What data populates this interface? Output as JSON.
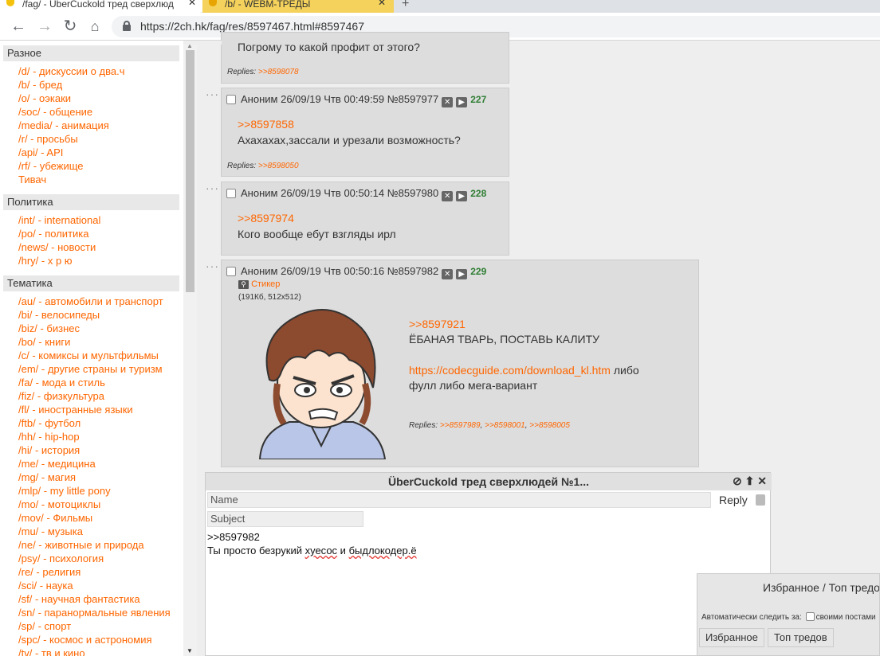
{
  "browser": {
    "tabs": [
      {
        "label": "/fag/ - ÜberCuckold тред сверхлюд"
      },
      {
        "label": "/b/ - WEBM-ТРЕДЫ"
      }
    ],
    "url": "https://2ch.hk/fag/res/8597467.html#8597467"
  },
  "sidebar": {
    "sections": [
      {
        "title": "Разное",
        "items": [
          {
            "label": "/d/ - дискуссии о два.ч"
          },
          {
            "label": "/b/ - бред"
          },
          {
            "label": "/o/ - оэкаки"
          },
          {
            "label": "/soc/ - общение"
          },
          {
            "label": "/media/ - анимация"
          },
          {
            "label": "/r/ - просьбы"
          },
          {
            "label": "/api/ - API"
          },
          {
            "label": "/rf/ - убежище"
          },
          {
            "label": "Тивач"
          }
        ]
      },
      {
        "title": "Политика",
        "items": [
          {
            "label": "/int/ - international"
          },
          {
            "label": "/po/ - политика"
          },
          {
            "label": "/news/ - новости"
          },
          {
            "label": "/hry/ - х р ю"
          }
        ]
      },
      {
        "title": "Тематика",
        "items": [
          {
            "label": "/au/ - автомобили и транспорт"
          },
          {
            "label": "/bi/ - велосипеды"
          },
          {
            "label": "/biz/ - бизнес"
          },
          {
            "label": "/bo/ - книги"
          },
          {
            "label": "/c/ - комиксы и мультфильмы"
          },
          {
            "label": "/em/ - другие страны и туризм"
          },
          {
            "label": "/fa/ - мода и стиль"
          },
          {
            "label": "/fiz/ - физкультура"
          },
          {
            "label": "/fl/ - иностранные языки"
          },
          {
            "label": "/ftb/ - футбол"
          },
          {
            "label": "/hh/ - hip-hop"
          },
          {
            "label": "/hi/ - история"
          },
          {
            "label": "/me/ - медицина"
          },
          {
            "label": "/mg/ - магия"
          },
          {
            "label": "/mlp/ - my little pony"
          },
          {
            "label": "/mo/ - мотоциклы"
          },
          {
            "label": "/mov/ - Фильмы"
          },
          {
            "label": "/mu/ - музыка"
          },
          {
            "label": "/ne/ - животные и природа"
          },
          {
            "label": "/psy/ - психология"
          },
          {
            "label": "/re/ - религия"
          },
          {
            "label": "/sci/ - наука"
          },
          {
            "label": "/sf/ - научная фантастика"
          },
          {
            "label": "/sn/ - паранормальные явления"
          },
          {
            "label": "/sp/ - спорт"
          },
          {
            "label": "/spc/ - космос и астрономия"
          },
          {
            "label": "/tv/ - тв и кино"
          }
        ]
      }
    ]
  },
  "posts": [
    {
      "text": "Погрому то какой профит от этого?",
      "replies_label": "Replies:",
      "replies": [
        ">>8598078"
      ]
    },
    {
      "name": "Аноним",
      "date": "26/09/19 Чтв 00:49:59",
      "num": "№8597977",
      "count": "227",
      "ref": ">>8597858",
      "text": "Ахахахах,зассали и урезали возможность?",
      "replies_label": "Replies:",
      "replies": [
        ">>8598050"
      ]
    },
    {
      "name": "Аноним",
      "date": "26/09/19 Чтв 00:50:14",
      "num": "№8597980",
      "count": "228",
      "ref": ">>8597974",
      "text": "Кого вообще ебут взгляды ирл"
    },
    {
      "name": "Аноним",
      "date": "26/09/19 Чтв 00:50:16",
      "num": "№8597982",
      "count": "229",
      "file_label": "Стикер",
      "file_meta": "(191Кб, 512x512)",
      "ref": ">>8597921",
      "text": "ЁБАНАЯ ТВАРЬ, ПОСТАВЬ КАЛИТУ",
      "link": "https://codecguide.com/download_kl.htm",
      "text2a": " либо",
      "text2b": "фулл либо мега-вариант",
      "replies_label": "Replies:",
      "replies": [
        ">>8597989",
        ">>8598001",
        ">>8598005"
      ]
    }
  ],
  "reply_form": {
    "title": "ÜberCuckold тред сверхлюдей №1...",
    "name_placeholder": "Name",
    "reply_label": "Reply",
    "subject_placeholder": "Subject",
    "text_line1": ">>8597982",
    "text_line2_a": "Ты просто безрукий ",
    "text_line2_b": "хуесос",
    "text_line2_c": " и ",
    "text_line2_d": "быдлокодер.ё"
  },
  "favorites": {
    "title": "Избранное / Топ тредов",
    "auto_label": "Автоматически следить за:",
    "auto_option": "своими постами",
    "btn_fav": "Избранное",
    "btn_top": "Топ тредов"
  },
  "colors": {
    "accent": "#ff6600",
    "count_green": "#2e7d32",
    "post_bg": "#dddddd"
  }
}
